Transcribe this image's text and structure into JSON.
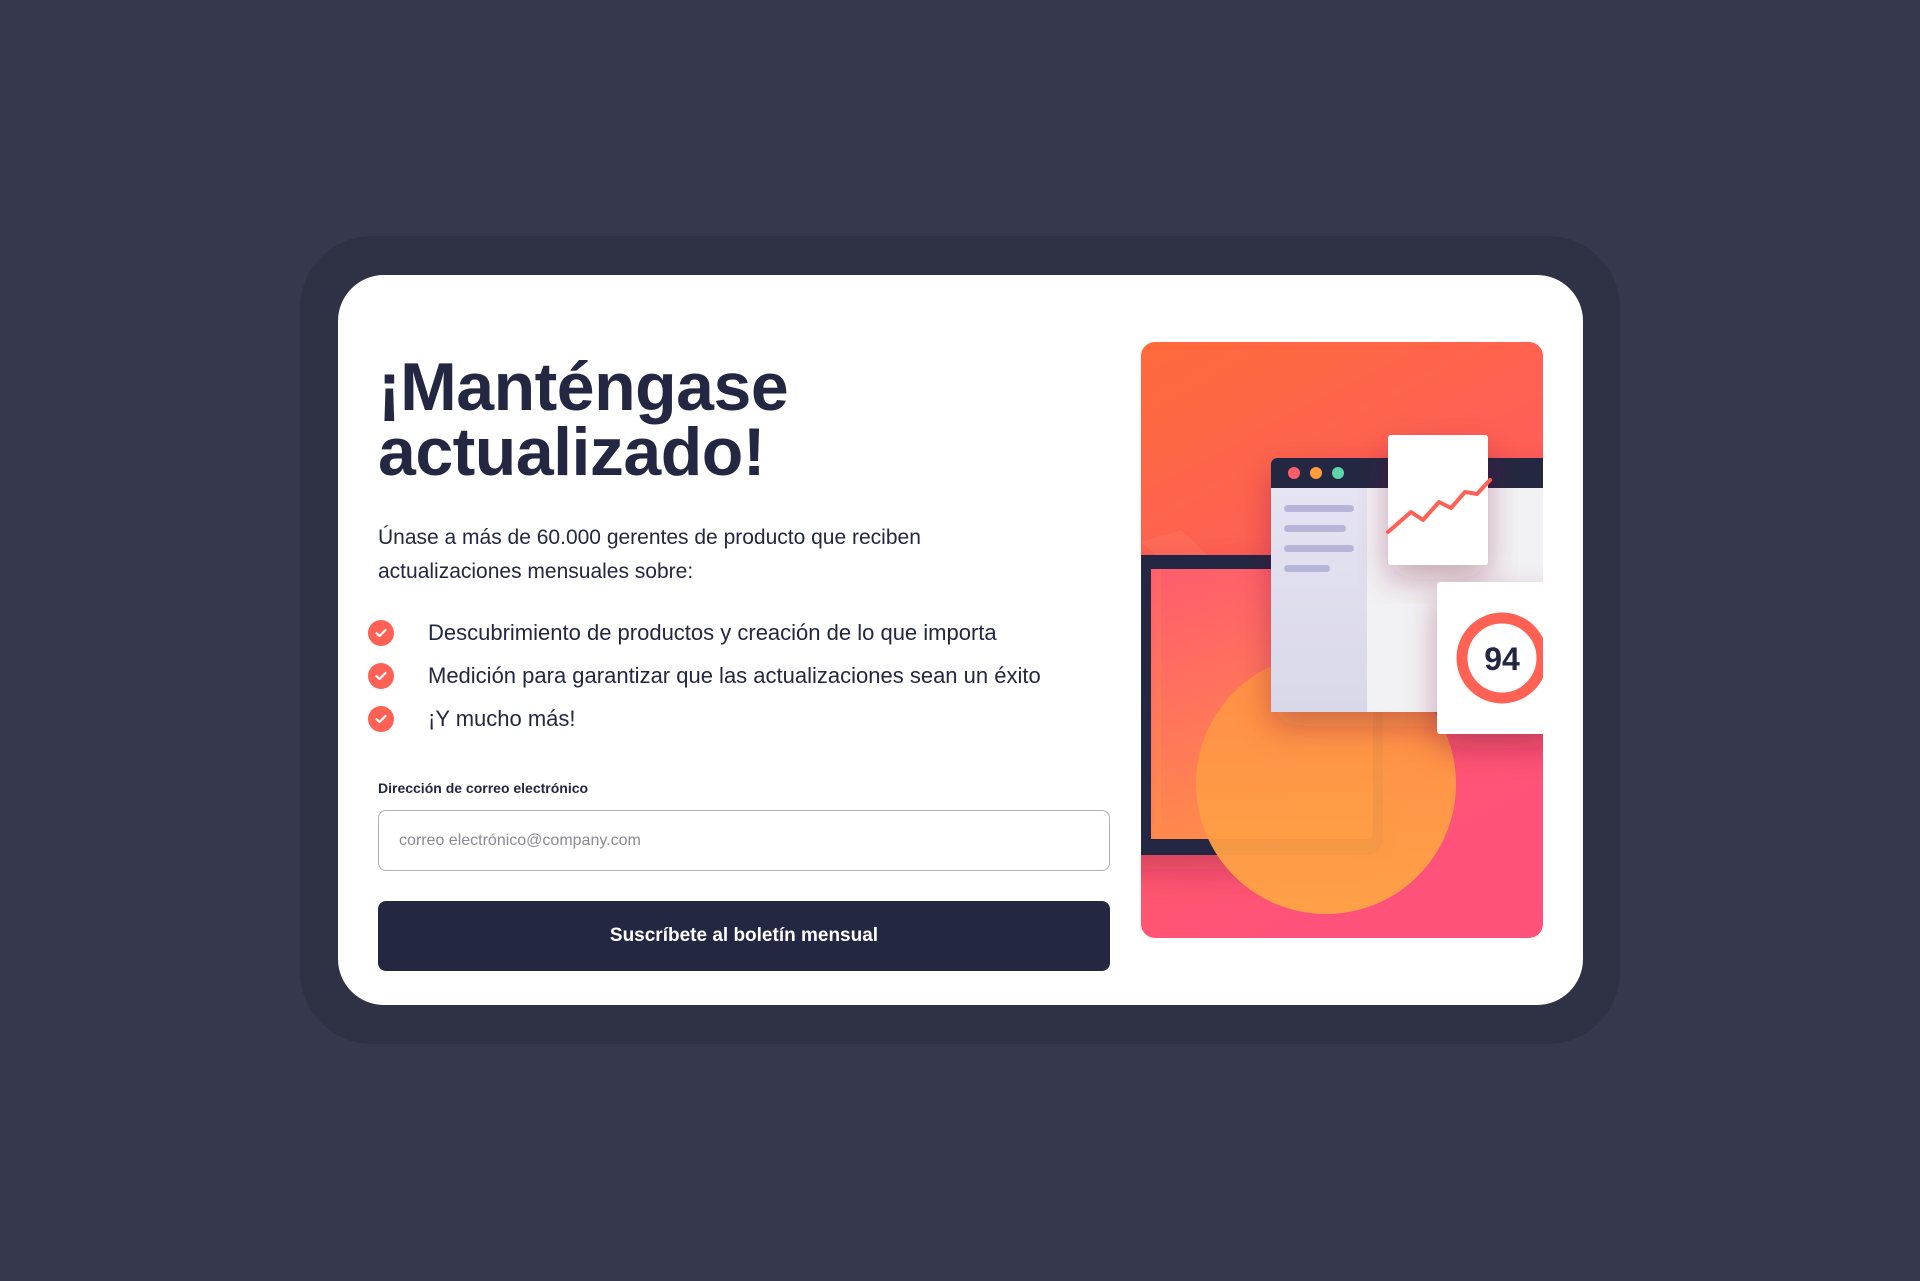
{
  "title_line1": "¡Manténgase",
  "title_line2": "actualizado!",
  "intro": "Únase a más de 60.000 gerentes de producto que reciben actualizaciones mensuales sobre:",
  "features": [
    "Descubrimiento de productos y creación de lo que importa",
    "Medición para garantizar que las actualizaciones sean un éxito",
    "¡Y mucho más!"
  ],
  "form": {
    "email_label": "Dirección de correo electrónico",
    "email_placeholder": "correo electrónico@company.com",
    "email_value": "",
    "submit_label": "Suscríbete al boletín mensual"
  },
  "illustration": {
    "score": "94"
  },
  "colors": {
    "background": "#36384e",
    "card": "#ffffff",
    "dark_navy": "#242742",
    "tomato": "#ff6155",
    "gradient_top": "#ff6a3a",
    "gradient_bottom": "#ff527b"
  }
}
